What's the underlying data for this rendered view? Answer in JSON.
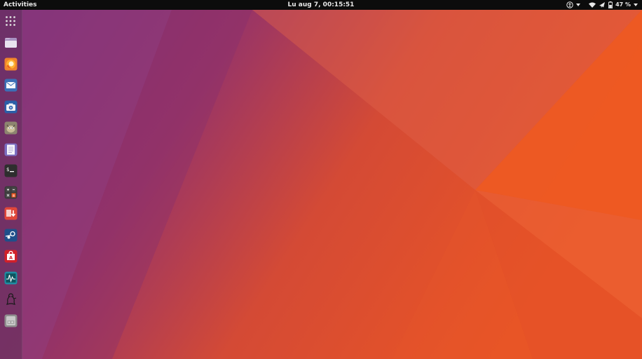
{
  "topbar": {
    "activities_label": "Activities",
    "clock": "Lu aug  7, 00:15:51",
    "battery_percent": "47 %",
    "tray_icons": [
      "accessibility-icon",
      "wifi-icon",
      "airplane-icon",
      "battery-icon"
    ]
  },
  "dock": {
    "items": [
      {
        "name": "app-grid-icon"
      },
      {
        "name": "files-icon"
      },
      {
        "name": "firefox-icon"
      },
      {
        "name": "mail-icon"
      },
      {
        "name": "screenshot-icon"
      },
      {
        "name": "gimp-icon"
      },
      {
        "name": "text-editor-icon"
      },
      {
        "name": "terminal-icon"
      },
      {
        "name": "calculator-icon"
      },
      {
        "name": "software-updater-icon"
      },
      {
        "name": "steam-icon"
      },
      {
        "name": "installer-icon"
      },
      {
        "name": "system-monitor-icon"
      },
      {
        "name": "tux-icon"
      },
      {
        "name": "disks-icon"
      }
    ]
  },
  "colors": {
    "purple": "#7a2f74",
    "magenta": "#9b3a6a",
    "orange": "#e95420",
    "topbar": "#0c0c0c"
  }
}
